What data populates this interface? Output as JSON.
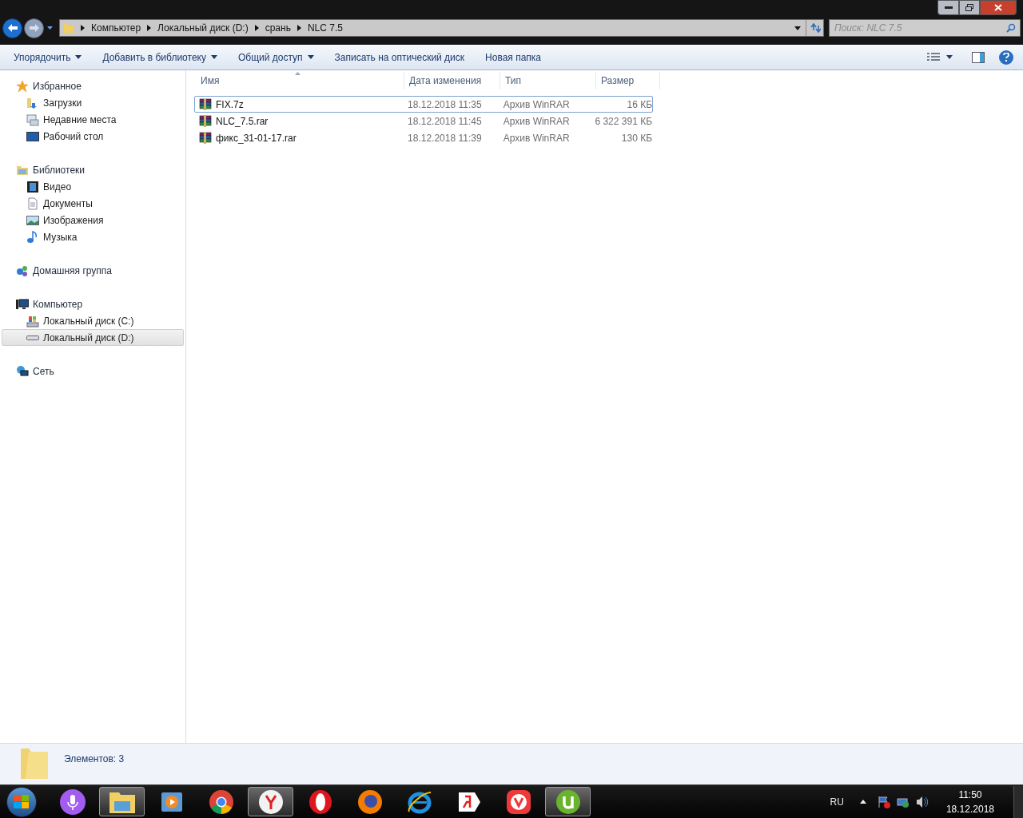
{
  "address_bar": {
    "crumbs": [
      "Компьютер",
      "Локальный диск (D:)",
      "срань",
      "NLC 7.5"
    ]
  },
  "search": {
    "placeholder": "Поиск: NLC 7.5"
  },
  "toolbar": {
    "items": [
      {
        "label": "Упорядочить",
        "dropdown": true
      },
      {
        "label": "Добавить в библиотеку",
        "dropdown": true
      },
      {
        "label": "Общий доступ",
        "dropdown": true
      },
      {
        "label": "Записать на оптический диск",
        "dropdown": false
      },
      {
        "label": "Новая папка",
        "dropdown": false
      }
    ]
  },
  "sidebar": {
    "groups": [
      {
        "label": "Избранное",
        "kind": "star",
        "children": [
          {
            "label": "Загрузки",
            "kind": "downloads",
            "selected": false
          },
          {
            "label": "Недавние места",
            "kind": "recent",
            "selected": false
          },
          {
            "label": "Рабочий стол",
            "kind": "desktop",
            "selected": false
          }
        ]
      },
      {
        "label": "Библиотеки",
        "kind": "libraries",
        "children": [
          {
            "label": "Видео",
            "kind": "video",
            "selected": false
          },
          {
            "label": "Документы",
            "kind": "documents",
            "selected": false
          },
          {
            "label": "Изображения",
            "kind": "pictures",
            "selected": false
          },
          {
            "label": "Музыка",
            "kind": "music",
            "selected": false
          }
        ]
      },
      {
        "label": "Домашняя группа",
        "kind": "homegroup"
      },
      {
        "label": "Компьютер",
        "kind": "computer",
        "children": [
          {
            "label": "Локальный диск (C:)",
            "kind": "system-drive",
            "selected": false
          },
          {
            "label": "Локальный диск (D:)",
            "kind": "drive",
            "selected": true
          }
        ]
      },
      {
        "label": "Сеть",
        "kind": "network"
      }
    ]
  },
  "table": {
    "columns": [
      "Имя",
      "Дата изменения",
      "Тип",
      "Размер"
    ],
    "rows": [
      {
        "name": "FIX.7z",
        "date": "18.12.2018 11:35",
        "type": "Архив WinRAR",
        "size": "16 КБ",
        "focused": true
      },
      {
        "name": "NLC_7.5.rar",
        "date": "18.12.2018 11:45",
        "type": "Архив WinRAR",
        "size": "6 322 391 КБ",
        "focused": false
      },
      {
        "name": "фикс_31-01-17.rar",
        "date": "18.12.2018 11:39",
        "type": "Архив WinRAR",
        "size": "130 КБ",
        "focused": false
      }
    ]
  },
  "status_bar": {
    "text": "Элементов: 3"
  },
  "taskbar": {
    "apps": [
      {
        "kind": "mic",
        "active": false
      },
      {
        "kind": "folder",
        "active": true
      },
      {
        "kind": "media",
        "active": false
      },
      {
        "kind": "chrome",
        "active": false
      },
      {
        "kind": "y-circle",
        "active": true
      },
      {
        "kind": "opera",
        "active": false
      },
      {
        "kind": "firefox",
        "active": false
      },
      {
        "kind": "ie",
        "active": false
      },
      {
        "kind": "tag",
        "active": false
      },
      {
        "kind": "vivaldi",
        "active": false
      },
      {
        "kind": "utorrent",
        "active": true
      }
    ],
    "language": "RU",
    "time": "11:50",
    "date": "18.12.2018"
  }
}
